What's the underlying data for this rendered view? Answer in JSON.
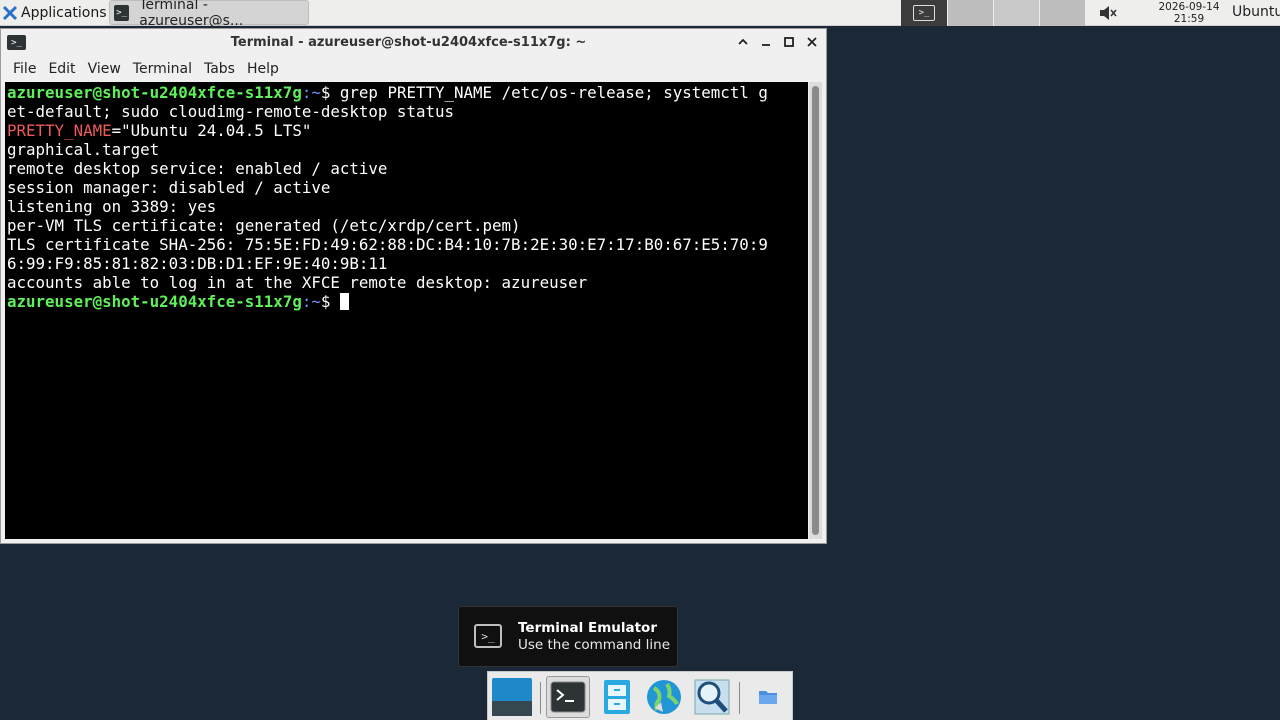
{
  "top_panel": {
    "applications_label": "Applications",
    "task_label": "Terminal - azureuser@s...",
    "clock_date": "2026-09-14",
    "clock_time": "21:59",
    "user": "Ubuntu"
  },
  "window": {
    "title": "Terminal - azureuser@shot-u2404xfce-s11x7g: ~",
    "menu": [
      "File",
      "Edit",
      "View",
      "Terminal",
      "Tabs",
      "Help"
    ]
  },
  "terminal": {
    "prompt_user": "azureuser@shot-u2404xfce-s11x7g",
    "prompt_path": ":~",
    "prompt_sym": "$",
    "command_line1": " grep PRETTY_NAME /etc/os-release; systemctl g",
    "command_line2": "et-default; sudo cloudimg-remote-desktop status",
    "pretty_key": "PRETTY_NAME",
    "pretty_val": "=\"Ubuntu 24.04.5 LTS\"",
    "out": [
      "graphical.target",
      "remote desktop service: enabled / active",
      "session manager: disabled / active",
      "listening on 3389: yes",
      "per-VM TLS certificate: generated (/etc/xrdp/cert.pem)",
      "TLS certificate SHA-256: 75:5E:FD:49:62:88:DC:B4:10:7B:2E:30:E7:17:B0:67:E5:70:9",
      "6:99:F9:85:81:82:03:DB:D1:EF:9E:40:9B:11",
      "accounts able to log in at the XFCE remote desktop: azureuser"
    ]
  },
  "tooltip": {
    "title": "Terminal Emulator",
    "subtitle": "Use the command line"
  },
  "dock": {
    "items": [
      "show-desktop-icon",
      "terminal-icon",
      "file-manager-icon",
      "web-browser-icon",
      "app-finder-icon",
      "folder-icon"
    ]
  },
  "colors": {
    "desktop_bg": "#1b2838",
    "prompt_user": "#5ff05a",
    "prompt_path": "#6f8fff",
    "highlight_key": "#ef5a5a"
  }
}
